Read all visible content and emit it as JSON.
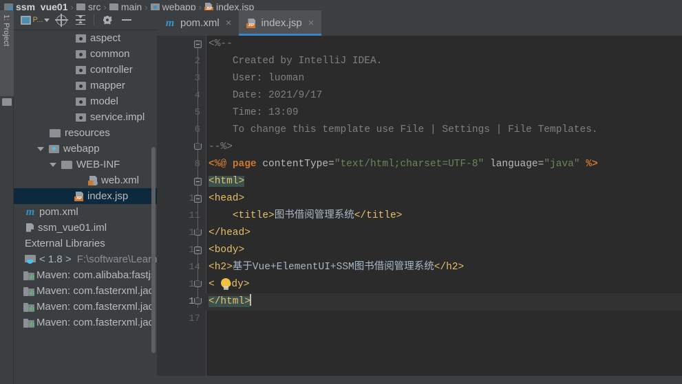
{
  "window": {
    "title": "ssm_vue01 - index.jsp"
  },
  "breadcrumb": {
    "separator": "›",
    "items": [
      {
        "label": "ssm_vue01",
        "icon": "module-icon",
        "bold": true
      },
      {
        "label": "src",
        "icon": "folder-icon",
        "bold": false
      },
      {
        "label": "main",
        "icon": "folder-icon",
        "bold": false
      },
      {
        "label": "webapp",
        "icon": "web-folder-icon",
        "bold": false
      },
      {
        "label": "index.jsp",
        "icon": "jsp-file-icon",
        "bold": false
      }
    ]
  },
  "tool_window_stripe": {
    "label": "1: Project"
  },
  "project_panel": {
    "toolbar": {
      "project_selector_label": "P...",
      "buttons": [
        {
          "name": "project-view-selector",
          "label": "P..."
        },
        {
          "name": "locate-file-button",
          "label": ""
        },
        {
          "name": "collapse-all-button",
          "label": ""
        },
        {
          "name": "settings-gear-button",
          "label": ""
        },
        {
          "name": "hide-panel-button",
          "label": ""
        }
      ]
    },
    "tree": [
      {
        "label": "aspect",
        "icon": "package-icon",
        "indent": 90,
        "arrow": false,
        "selected": false,
        "style": "normal"
      },
      {
        "label": "common",
        "icon": "package-icon",
        "indent": 90,
        "arrow": false,
        "selected": false,
        "style": "normal"
      },
      {
        "label": "controller",
        "icon": "package-icon",
        "indent": 90,
        "arrow": false,
        "selected": false,
        "style": "normal"
      },
      {
        "label": "mapper",
        "icon": "package-icon",
        "indent": 90,
        "arrow": false,
        "selected": false,
        "style": "normal"
      },
      {
        "label": "model",
        "icon": "package-icon",
        "indent": 90,
        "arrow": false,
        "selected": false,
        "style": "normal"
      },
      {
        "label": "service.impl",
        "icon": "package-icon",
        "indent": 90,
        "arrow": false,
        "selected": false,
        "style": "normal"
      },
      {
        "label": "resources",
        "icon": "folder-icon",
        "indent": 52,
        "arrow": false,
        "selected": false,
        "style": "normal"
      },
      {
        "label": "webapp",
        "icon": "web-folder-icon",
        "indent": 52,
        "arrow": true,
        "selected": false,
        "style": "normal"
      },
      {
        "label": "WEB-INF",
        "icon": "folder-icon",
        "indent": 70,
        "arrow": true,
        "selected": false,
        "style": "normal"
      },
      {
        "label": "web.xml",
        "icon": "xml-file-icon",
        "indent": 108,
        "arrow": false,
        "selected": false,
        "style": "normal"
      },
      {
        "label": "index.jsp",
        "icon": "jsp-file-icon",
        "indent": 88,
        "arrow": false,
        "selected": true,
        "style": "normal"
      },
      {
        "label": "pom.xml",
        "icon": "maven-m-icon",
        "indent": 0,
        "arrow": false,
        "selected": false,
        "style": "normal"
      },
      {
        "label": "ssm_vue01.iml",
        "icon": "iml-file-icon",
        "indent": 0,
        "arrow": false,
        "selected": false,
        "style": "normal"
      },
      {
        "label": "External Libraries",
        "icon": "none",
        "indent": 16,
        "arrow": false,
        "selected": false,
        "style": "normal"
      },
      {
        "label": "< 1.8 >",
        "icon": "jdk-icon",
        "indent": 0,
        "arrow": false,
        "selected": false,
        "style": "version",
        "suffix": "F:\\software\\Learn"
      },
      {
        "label": "Maven: com.alibaba:fastjs",
        "icon": "maven-lib-icon",
        "indent": 0,
        "arrow": false,
        "selected": false,
        "style": "normal"
      },
      {
        "label": "Maven: com.fasterxml.jac",
        "icon": "maven-lib-icon",
        "indent": 0,
        "arrow": false,
        "selected": false,
        "style": "normal"
      },
      {
        "label": "Maven: com.fasterxml.jac",
        "icon": "maven-lib-icon",
        "indent": 0,
        "arrow": false,
        "selected": false,
        "style": "normal"
      },
      {
        "label": "Maven: com.fasterxml.jac",
        "icon": "maven-lib-icon",
        "indent": 0,
        "arrow": false,
        "selected": false,
        "style": "normal"
      }
    ]
  },
  "editor": {
    "tabs": [
      {
        "label": "pom.xml",
        "icon": "maven-m-icon",
        "active": false,
        "close": "×"
      },
      {
        "label": "index.jsp",
        "icon": "jsp-file-icon",
        "active": true,
        "close": "×"
      }
    ],
    "current_line": 16,
    "line_numbers": [
      "1",
      "2",
      "3",
      "4",
      "5",
      "6",
      "7",
      "8",
      "9",
      "10",
      "11",
      "12",
      "13",
      "14",
      "15",
      "16",
      "17"
    ],
    "lines": [
      {
        "n": "1",
        "text": "<%--"
      },
      {
        "n": "2",
        "text": "    Created by IntelliJ IDEA."
      },
      {
        "n": "3",
        "text": "    User: luoman"
      },
      {
        "n": "4",
        "text": "    Date: 2021/9/17"
      },
      {
        "n": "5",
        "text": "    Time: 13:09"
      },
      {
        "n": "6",
        "text": "    To change this template use File | Settings | File Templates."
      },
      {
        "n": "7",
        "text": "--%>"
      },
      {
        "n": "8",
        "text": "<%@ page contentType=\"text/html;charset=UTF-8\" language=\"java\" %>"
      },
      {
        "n": "9",
        "text": "<html>"
      },
      {
        "n": "10",
        "text": "<head>"
      },
      {
        "n": "11",
        "text": "    <title>图书借阅管理系统</title>"
      },
      {
        "n": "12",
        "text": "</head>"
      },
      {
        "n": "13",
        "text": "<body>"
      },
      {
        "n": "14",
        "text": "<h2>基于Vue+ElementUI+SSM图书借阅管理系统</h2>"
      },
      {
        "n": "15",
        "text": "</body>"
      },
      {
        "n": "16",
        "text": "</html>"
      },
      {
        "n": "17",
        "text": ""
      }
    ],
    "tokens": {
      "comment_open": "<%--",
      "comment_l2": "Created by IntelliJ IDEA.",
      "comment_l3": "User: luoman",
      "comment_l4": "Date: 2021/9/17",
      "comment_l5": "Time: 13:09",
      "comment_l6": "To change this template use File | Settings | File Templates.",
      "comment_close": "--%>",
      "directive_open": "<%@",
      "directive_name": "page",
      "attr_contenttype": "contentType=",
      "val_contenttype": "\"text/html;charset=UTF-8\"",
      "attr_language": "language=",
      "val_language": "\"java\"",
      "directive_close": "%>",
      "tag_html_open": "<html>",
      "tag_head_open": "<head>",
      "tag_title_open": "<title>",
      "title_text": "图书借阅管理系统",
      "tag_title_close": "</title>",
      "tag_head_close": "</head>",
      "tag_body_open": "<body>",
      "tag_h2_open": "<h2>",
      "h2_text": "基于Vue+ElementUI+SSM图书借阅管理系统",
      "tag_h2_close": "</h2>",
      "tag_body_close_lt": "<",
      "tag_body_close_rest": "ody>",
      "tag_html_close": "</html>"
    },
    "intention_bulb": {
      "name": "intention-bulb-icon",
      "line": 15
    }
  },
  "colors": {
    "editor_bg": "#2b2b2b",
    "gutter_bg": "#313335",
    "panel_bg": "#3c3f41",
    "selection_bg": "#0d293e",
    "current_line_bg": "#323232",
    "match_highlight": "#3b514d",
    "tab_active_underline": "#3b86c9",
    "tag_color": "#e8bf6a",
    "string_color": "#6a8759",
    "keyword_color": "#cc7832",
    "comment_color": "#808080",
    "text_color": "#a9b7c6",
    "bulb_yellow": "#f0c040"
  }
}
